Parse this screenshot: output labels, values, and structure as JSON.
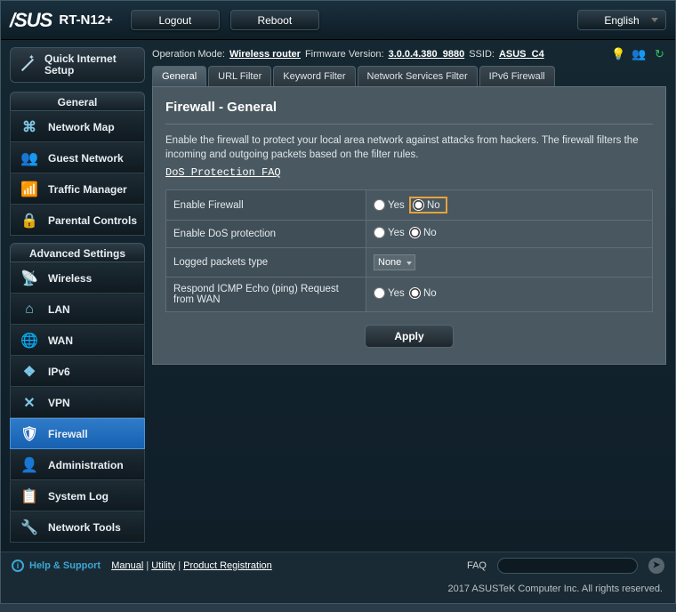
{
  "header": {
    "brand": "/SUS",
    "model": "RT-N12+",
    "logout": "Logout",
    "reboot": "Reboot",
    "language": "English"
  },
  "infobar": {
    "opmode_label": "Operation Mode:",
    "opmode_value": "Wireless router",
    "fw_label": "Firmware Version:",
    "fw_value": "3.0.0.4.380_9880",
    "ssid_label": "SSID:",
    "ssid_value": "ASUS_C4"
  },
  "sidebar": {
    "qis_line1": "Quick Internet",
    "qis_line2": "Setup",
    "general_head": "General",
    "advanced_head": "Advanced Settings",
    "general_items": [
      {
        "label": "Network Map",
        "icon": "⌘"
      },
      {
        "label": "Guest Network",
        "icon": "👥"
      },
      {
        "label": "Traffic Manager",
        "icon": "📶"
      },
      {
        "label": "Parental Controls",
        "icon": "🔒"
      }
    ],
    "advanced_items": [
      {
        "label": "Wireless",
        "icon": "📡"
      },
      {
        "label": "LAN",
        "icon": "⌂"
      },
      {
        "label": "WAN",
        "icon": "🌐"
      },
      {
        "label": "IPv6",
        "icon": "❖"
      },
      {
        "label": "VPN",
        "icon": "✕"
      },
      {
        "label": "Firewall",
        "icon": "🛡"
      },
      {
        "label": "Administration",
        "icon": "👤"
      },
      {
        "label": "System Log",
        "icon": "📋"
      },
      {
        "label": "Network Tools",
        "icon": "🔧"
      }
    ]
  },
  "tabs": [
    "General",
    "URL Filter",
    "Keyword Filter",
    "Network Services Filter",
    "IPv6 Firewall"
  ],
  "panel": {
    "title": "Firewall - General",
    "desc": "Enable the firewall to protect your local area network against attacks from hackers. The firewall filters the incoming and outgoing packets based on the filter rules.",
    "faq": "DoS Protection FAQ",
    "rows": {
      "r1_label": "Enable Firewall",
      "r2_label": "Enable DoS protection",
      "r3_label": "Logged packets type",
      "r3_value": "None",
      "r4_label": "Respond ICMP Echo (ping) Request from WAN"
    },
    "yes": "Yes",
    "no": "No",
    "apply": "Apply"
  },
  "footer": {
    "help": "Help & Support",
    "manual": "Manual",
    "utility": "Utility",
    "product_reg": "Product Registration",
    "faq": "FAQ",
    "copyright": "2017 ASUSTeK Computer Inc. All rights reserved."
  }
}
